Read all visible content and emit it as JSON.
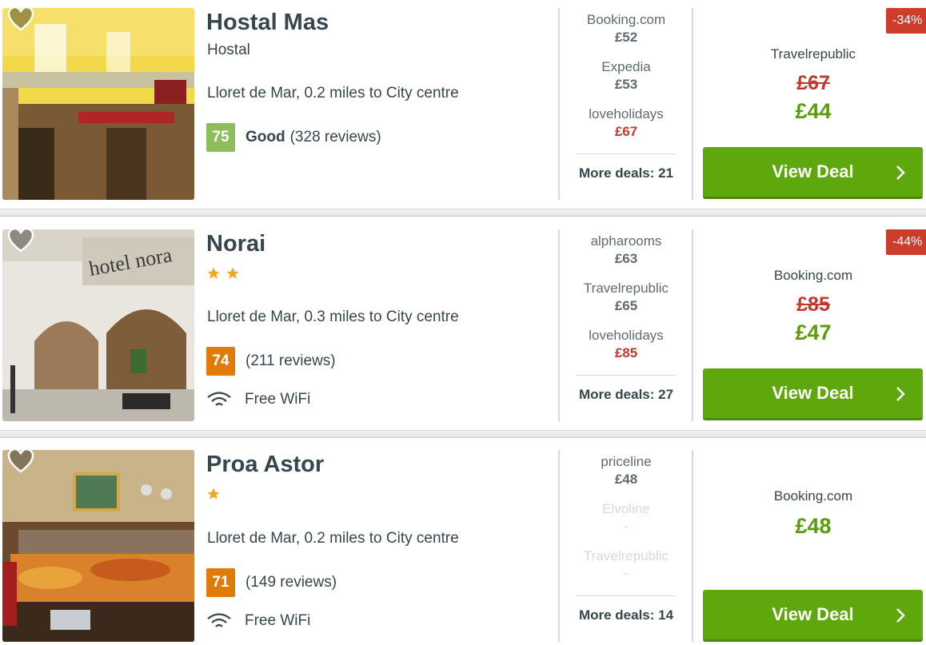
{
  "colors": {
    "good_green": "#5ea80d",
    "score_good": "#8dbe5b",
    "score_ok": "#e07b08",
    "discount_red": "#cc3d2c",
    "star": "#f5a623"
  },
  "hotels": [
    {
      "name": "Hostal Mas",
      "type": "Hostal",
      "location": "Lloret de Mar, 0.2 miles to City centre",
      "score": "75",
      "rating_label": "Good",
      "reviews": "(328 reviews)",
      "deals": [
        {
          "provider": "Booking.com",
          "price": "£52"
        },
        {
          "provider": "Expedia",
          "price": "£53"
        },
        {
          "provider": "loveholidays",
          "price": "£67"
        }
      ],
      "more_deals": "More deals: 21",
      "discount": "-34%",
      "best_provider": "Travelrepublic",
      "old_price": "£67",
      "price": "£44",
      "cta": "View Deal"
    },
    {
      "name": "Norai",
      "stars": 2,
      "location": "Lloret de Mar, 0.3 miles to City centre",
      "score": "74",
      "reviews": "(211 reviews)",
      "amenity": "Free WiFi",
      "deals": [
        {
          "provider": "alpharooms",
          "price": "£63"
        },
        {
          "provider": "Travelrepublic",
          "price": "£65"
        },
        {
          "provider": "loveholidays",
          "price": "£85"
        }
      ],
      "more_deals": "More deals: 27",
      "discount": "-44%",
      "best_provider": "Booking.com",
      "old_price": "£85",
      "price": "£47",
      "cta": "View Deal"
    },
    {
      "name": "Proa Astor",
      "stars": 1,
      "location": "Lloret de Mar, 0.2 miles to City centre",
      "score": "71",
      "reviews": "(149 reviews)",
      "amenity": "Free WiFi",
      "deals": [
        {
          "provider": "priceline",
          "price": "£48"
        },
        {
          "provider": "Elvoline",
          "price": "-"
        },
        {
          "provider": "Travelrepublic",
          "price": "-"
        }
      ],
      "more_deals": "More deals: 14",
      "best_provider": "Booking.com",
      "price": "£48",
      "cta": "View Deal"
    }
  ]
}
